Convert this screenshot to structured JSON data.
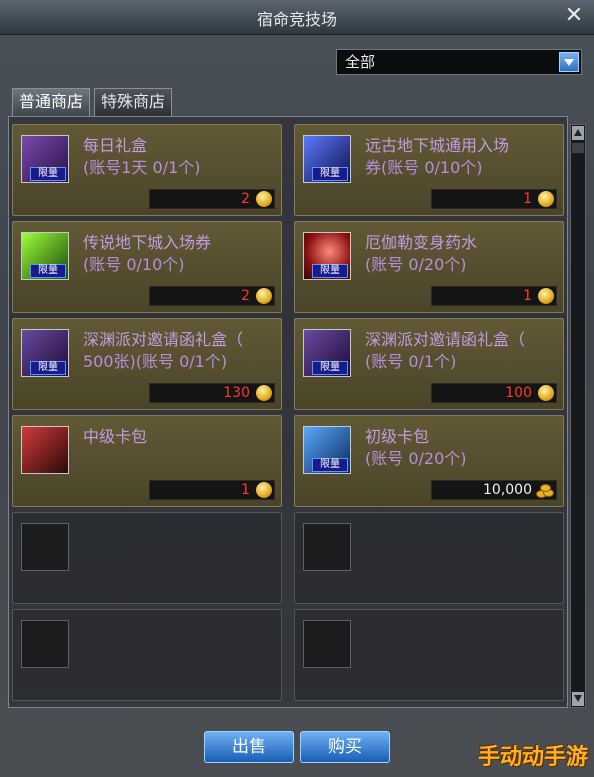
{
  "window": {
    "title": "宿命竞技场",
    "close_symbol": "✕"
  },
  "filter": {
    "selected": "全部"
  },
  "tabs": [
    {
      "label": "普通商店",
      "active": true
    },
    {
      "label": "特殊商店",
      "active": false
    }
  ],
  "items": [
    {
      "name": "每日礼盒",
      "sub": "(账号1天 0/1个)",
      "price": "2",
      "tag": "限量",
      "icon_color": "#5a2a8c"
    },
    {
      "name": "远古地下城通用入场",
      "sub": "券(账号 0/10个)",
      "price": "1",
      "tag": "限量",
      "icon_color": "#2c3f9c"
    },
    {
      "name": "传说地下城入场券",
      "sub": "(账号 0/10个)",
      "price": "2",
      "tag": "限量",
      "icon_color": "#3c8a1c"
    },
    {
      "name": "厄伽勒变身药水",
      "sub": "(账号 0/20个)",
      "price": "1",
      "tag": "限量",
      "icon_color": "#c0392b"
    },
    {
      "name": "深渊派对邀请函礼盒（",
      "sub": "500张)(账号 0/1个)",
      "price": "130",
      "tag": "限量",
      "icon_color": "#4a2a7a"
    },
    {
      "name": "深渊派对邀请函礼盒（",
      "sub": "(账号 0/1个)",
      "price": "100",
      "tag": "限量",
      "icon_color": "#4a2a7a"
    },
    {
      "name": "中级卡包",
      "sub": "",
      "price": "1",
      "tag": "",
      "icon_color": "#8a1a1a"
    },
    {
      "name": "初级卡包",
      "sub": "(账号 0/20个)",
      "price": "10,000",
      "tag": "限量",
      "icon_color": "#1a5aa8",
      "currency": "gold"
    }
  ],
  "buttons": {
    "sell": "出售",
    "buy": "购买"
  },
  "watermark": "手动动手游",
  "colors": {
    "accent": "#3a86d8",
    "price_red": "#ff3a2d",
    "item_name": "#c29be0"
  }
}
